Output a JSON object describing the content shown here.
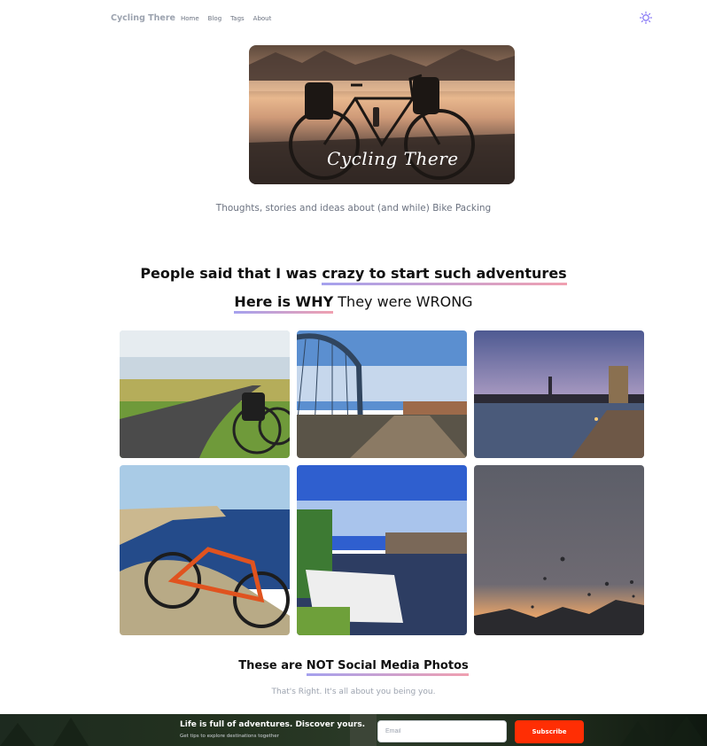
{
  "nav": {
    "brand": "Cycling There",
    "links": [
      "Home",
      "Blog",
      "Tags",
      "About"
    ],
    "theme_icon": "sun-icon"
  },
  "hero": {
    "script_text": "Cycling There",
    "tagline": "Thoughts, stories and ideas about (and while) Bike Packing"
  },
  "headline": {
    "line1_plain": "People said that I was ",
    "line1_underlined": "crazy to start such adventures",
    "line2_underlined": "Here is WHY",
    "line2_plain": " They were WRONG"
  },
  "gallery": {
    "photos": [
      "coastal-road-bike-photo",
      "bridge-photo",
      "river-city-sunset-photo",
      "cliff-bike-photo",
      "canal-boats-photo",
      "hot-air-balloons-sunset-photo"
    ]
  },
  "closing": {
    "plain": "These are ",
    "underlined": "NOT Social Media Photos",
    "subtitle": "That's Right. It's all about you being you."
  },
  "newsletter": {
    "title": "Life is full of adventures. Discover yours.",
    "subtitle": "Get tips to explore destinations together",
    "email_placeholder": "Email",
    "button_label": "Subscribe",
    "accent": "#ff2e04"
  }
}
